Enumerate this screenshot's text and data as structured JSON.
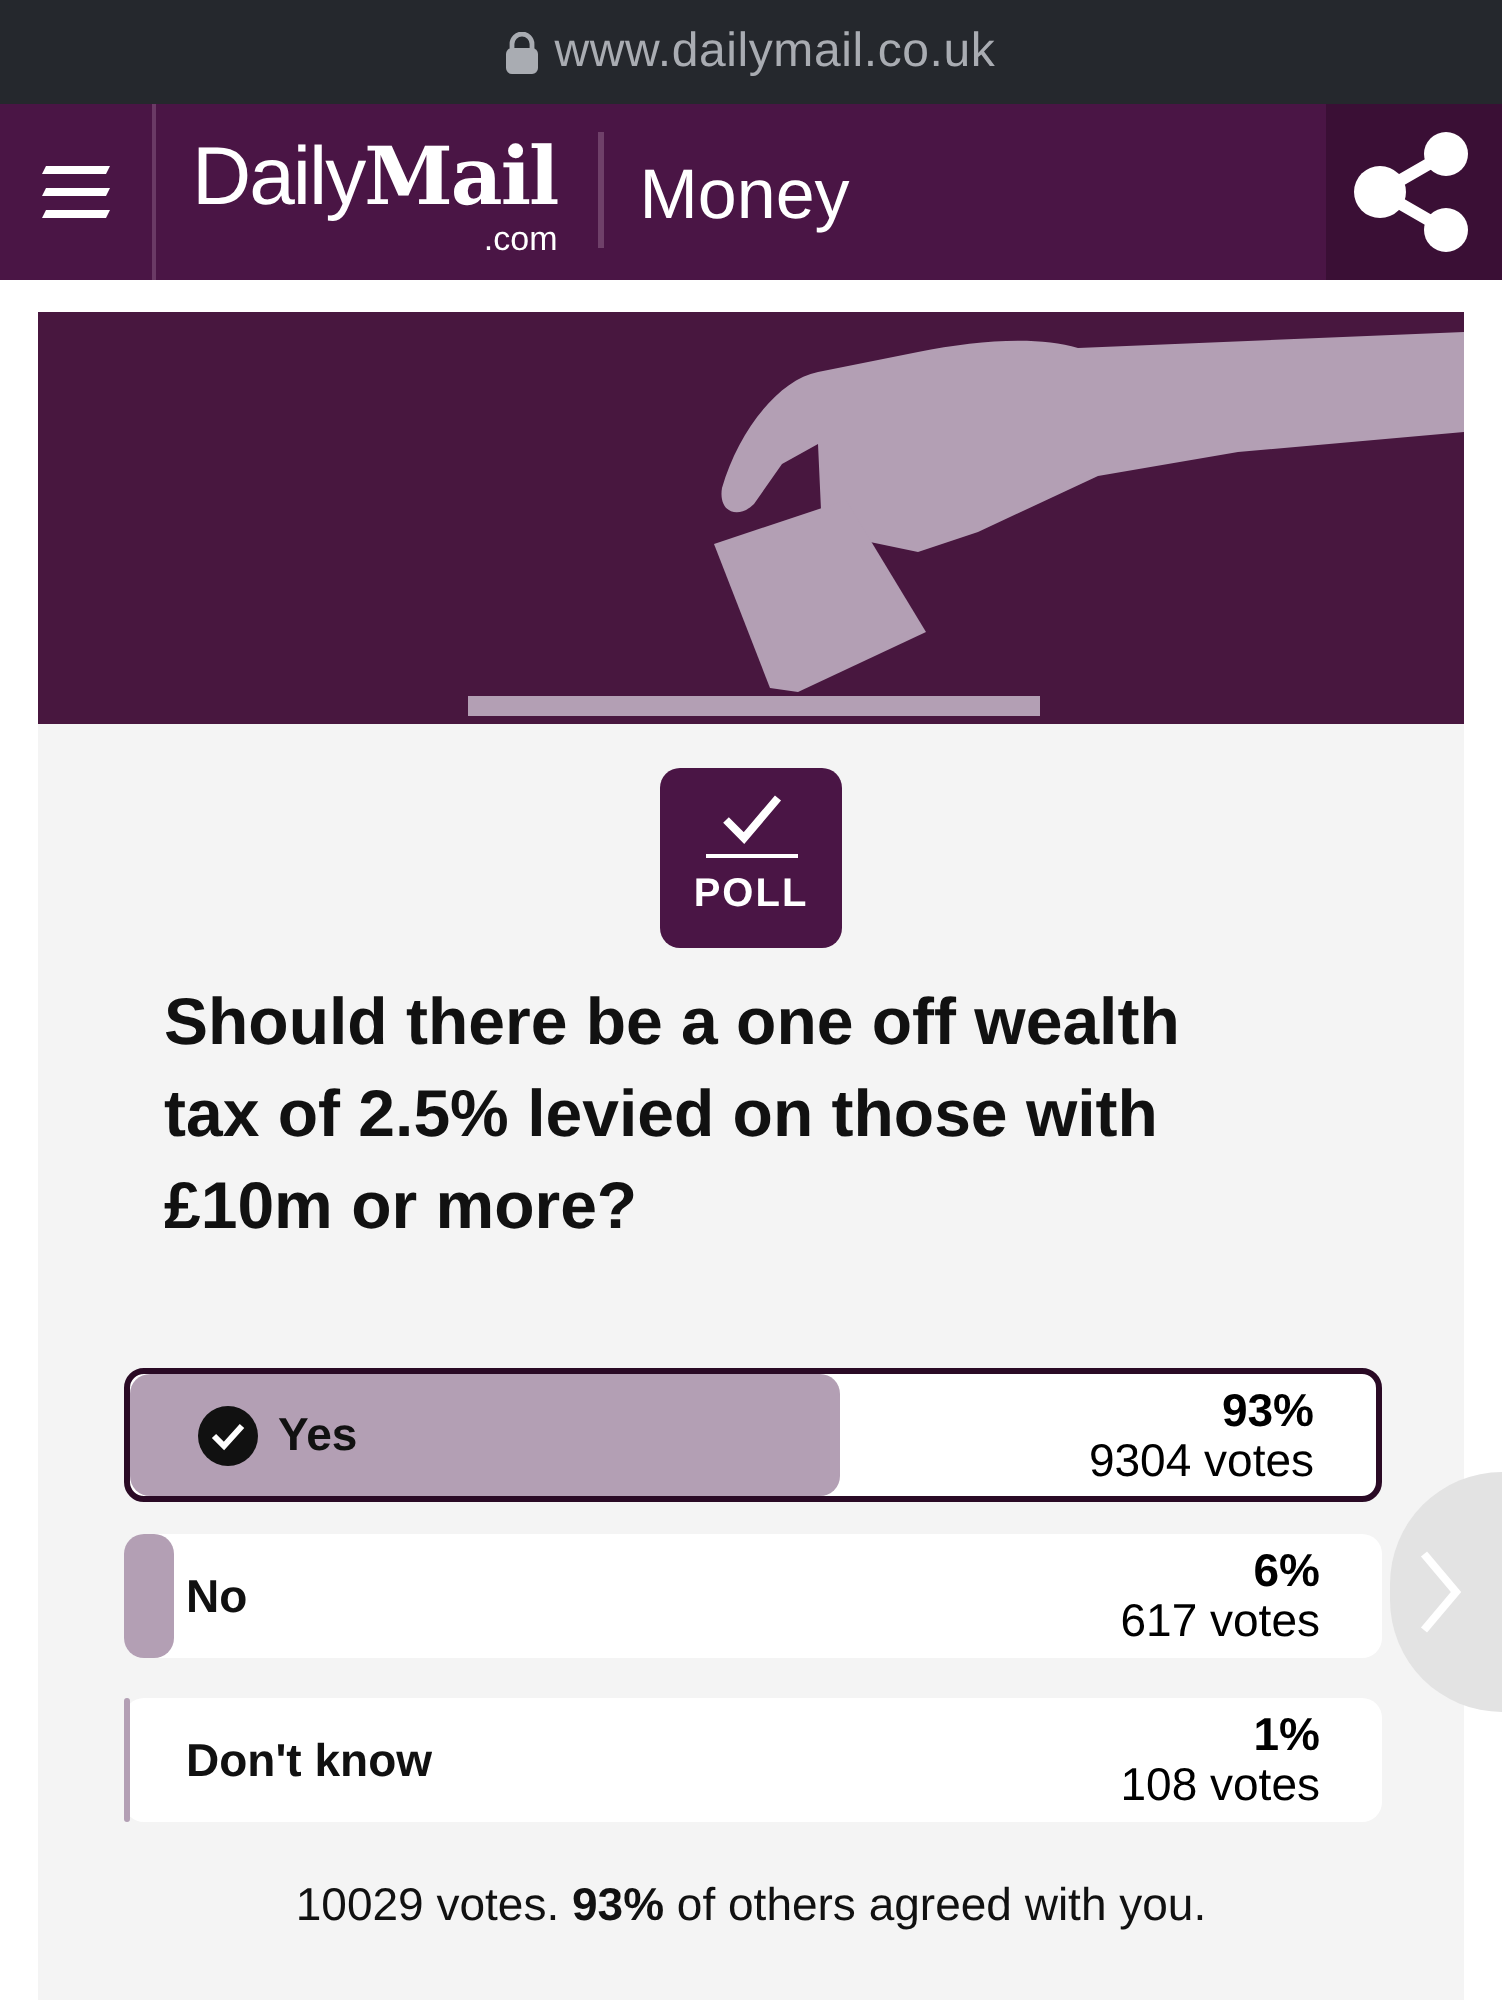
{
  "browser": {
    "url": "www.dailymail.co.uk"
  },
  "header": {
    "logo": {
      "light": "Daily",
      "bold": "Mail",
      "domain": ".com"
    },
    "section": "Money"
  },
  "poll": {
    "badge": "POLL",
    "question": "Should there be a one off wealth tax of 2.5% levied on those with £10m or more?",
    "options": [
      {
        "label": "Yes",
        "selected": true,
        "level": 0.57,
        "percent": "93%",
        "votes": "9304 votes"
      },
      {
        "label": "No",
        "selected": false,
        "level": 0.04,
        "percent": "6%",
        "votes": "617 votes"
      },
      {
        "label": "Don't know",
        "selected": false,
        "level": 0.005,
        "percent": "1%",
        "votes": "108 votes"
      }
    ],
    "summary": "10029 votes. **93%** of others agreed with you."
  }
}
